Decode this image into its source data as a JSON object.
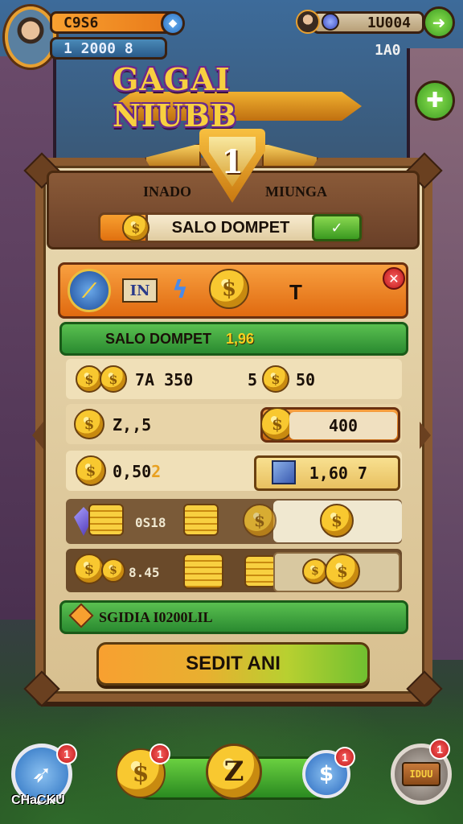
{
  "hud": {
    "top_left_value": "C9S6",
    "top_left_value2": "1 2000 8",
    "top_right_value": "1U004",
    "top_right_value2": "1A0",
    "blue_btn_glyph": "◆",
    "green_top_glyph": "➜",
    "green_plus_glyph": "✚"
  },
  "title": "GAGAI NIUBB",
  "header": {
    "rank": "1",
    "left_label": "INADO",
    "right_label": "MIUNGA",
    "wallet_label": "SALO DOMPET"
  },
  "tabs": {
    "in_label": "IN",
    "t_label": "T",
    "close_glyph": "✕"
  },
  "rows": {
    "wallet_row_label": "SALO DOMPET",
    "wallet_row_value": "1,96",
    "row1_left": "7A 350",
    "row1_mid": "5",
    "row1_right": "50",
    "row2_left": "Z,,5",
    "row2_right": "400",
    "row3_left": "0,50",
    "row3_left_accent": "2",
    "row3_right": "1,60 7",
    "row4_left": "0S18",
    "row5_left": "8.45"
  },
  "footer_row_label": "SGIDIA I0200LIL",
  "cta_label": "SEDIT ANI",
  "bottom": {
    "left_label": "CHaCKU",
    "left_badge": "1",
    "coin_badge": "1",
    "blue_badge": "1",
    "chest_badge": "1",
    "center_glyph": "Z",
    "chest_text": "IDUU"
  },
  "colors": {
    "accent_orange": "#f8a030",
    "accent_green": "#3a9a20",
    "panel": "#e8d8b0"
  }
}
